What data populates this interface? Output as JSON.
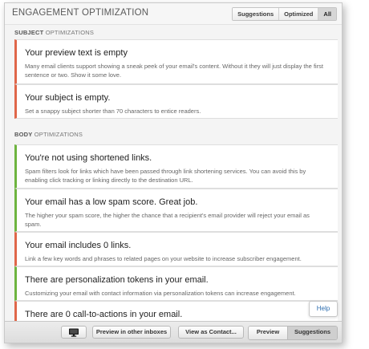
{
  "header": {
    "title": "ENGAGEMENT OPTIMIZATION",
    "filters": [
      {
        "label": "Suggestions"
      },
      {
        "label": "Optimized"
      },
      {
        "label": "All",
        "active": true
      }
    ]
  },
  "subject_section": {
    "bold": "SUBJECT",
    "rest": " OPTIMIZATIONS"
  },
  "body_section": {
    "bold": "BODY",
    "rest": " OPTIMIZATIONS"
  },
  "subject_items": [
    {
      "status": "warning",
      "title": "Your preview text is empty",
      "description": "Many email clients support showing a sneak peek of your email's content. Without it they will just display the first sentence or two. Show it some love."
    },
    {
      "status": "warning",
      "title": "Your subject is empty.",
      "description": "Set a snappy subject shorter than 70 characters to entice readers."
    }
  ],
  "body_items": [
    {
      "status": "good",
      "title": "You're not using shortened links.",
      "description": "Spam filters look for links which have been passed through link shortening services. You can avoid this by enabling click tracking or linking directly to the destination URL."
    },
    {
      "status": "good",
      "title": "Your email has a low spam score. Great job.",
      "description": "The higher your spam score, the higher the chance that a recipient's email provider will reject your email as spam."
    },
    {
      "status": "warning",
      "title": "Your email includes 0 links.",
      "description": "Link a few key words and phrases to related pages on your website to increase subscriber engagement."
    },
    {
      "status": "good",
      "title": "There are personalization tokens in your email.",
      "description": "Customizing your email with contact information via personalization tokens can increase engagement."
    },
    {
      "status": "warning",
      "title": "There are 0 call-to-actions in your email.",
      "description": ""
    }
  ],
  "help_label": "Help",
  "footer": {
    "desktop_icon": "monitor-icon",
    "preview_inboxes": "Preview in other inboxes",
    "view_as_contact": "View as Contact...",
    "tabs": [
      {
        "label": "Preview"
      },
      {
        "label": "Suggestions",
        "active": true
      }
    ]
  },
  "colors": {
    "warning": "#e0674a",
    "good": "#6eb43f",
    "link": "#2f6fb0"
  }
}
